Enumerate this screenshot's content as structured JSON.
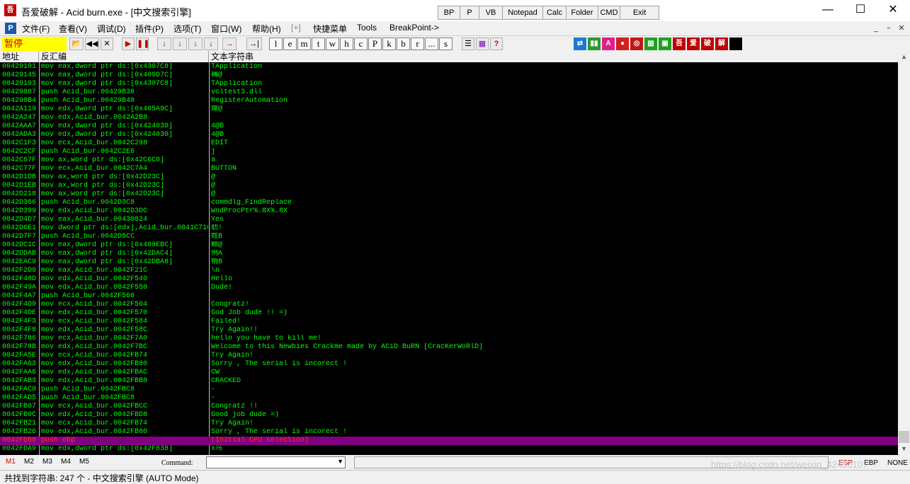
{
  "window": {
    "title": "吾爱破解 - Acid burn.exe - [中文搜索引擎]",
    "app_icon_text": "吾",
    "quick_buttons": [
      "BP",
      "P",
      "VB",
      "Notepad",
      "Calc",
      "Folder",
      "CMD",
      "Exit"
    ],
    "minimize": "—",
    "maximize": "☐",
    "close": "✕"
  },
  "menu": {
    "icon_text": "P",
    "items": [
      "文件(F)",
      "查看(V)",
      "调试(D)",
      "插件(P)",
      "选项(T)",
      "窗口(W)",
      "帮助(H)",
      "[+]",
      "快捷菜单",
      "Tools",
      "BreakPoint->"
    ],
    "mdi_minimize": "_",
    "mdi_restore": "▫",
    "mdi_close": "✕"
  },
  "toolbar": {
    "status": "暂停",
    "debug_icons": [
      "📂",
      "◀◀",
      "✕",
      "▶",
      "❚❚",
      "↓",
      "↓",
      "↓",
      "↓",
      "→"
    ],
    "letters": [
      "l",
      "e",
      "m",
      "t",
      "w",
      "h",
      "c",
      "P",
      "k",
      "b",
      "r",
      "...",
      "s"
    ],
    "view_icons": [
      "☰",
      "▦",
      "?"
    ],
    "color_icons": [
      {
        "glyph": "⇄",
        "color": "#1e78d2"
      },
      {
        "glyph": "▮▮",
        "color": "#2a9a2a"
      },
      {
        "glyph": "A",
        "color": "#e0208a"
      },
      {
        "glyph": "●",
        "color": "#d02020"
      },
      {
        "glyph": "◎",
        "color": "#c01818"
      },
      {
        "glyph": "▥",
        "color": "#20a020"
      },
      {
        "glyph": "▣",
        "color": "#20a020"
      },
      {
        "glyph": "吾",
        "color": "#c00000"
      },
      {
        "glyph": "爱",
        "color": "#c00000"
      },
      {
        "glyph": "破",
        "color": "#c00000"
      },
      {
        "glyph": "解",
        "color": "#c00000"
      },
      {
        "glyph": "",
        "color": "#000000"
      }
    ]
  },
  "table": {
    "headers": [
      "地址",
      "反汇编",
      "文本字符串"
    ],
    "rows": [
      [
        "00429101",
        "mov eax,dword ptr ds:[0x4307C8]",
        "TApplication"
      ],
      [
        "00429145",
        "mov eax,dword ptr ds:[0x409D7C]",
        "鞴@"
      ],
      [
        "00429193",
        "mov eax,dword ptr ds:[0x4307C8]",
        "TApplication"
      ],
      [
        "00429887",
        "push Acid_bur.00429B38",
        "vcltest3.dll"
      ],
      [
        "004298B4",
        "push Acid_bur.00429B48",
        "RegisterAutomation"
      ],
      [
        "0042A119",
        "mov edx,dword ptr ds:[0x405A9C]",
        "煒@"
      ],
      [
        "0042A247",
        "mov edx,Acid_bur.0042A2B8",
        ""
      ],
      [
        "0042AAA7",
        "mov edx,dword ptr ds:[0x424030]",
        "4@B"
      ],
      [
        "0042ADA3",
        "mov edx,dword ptr ds:[0x424030]",
        "4@B"
      ],
      [
        "0042C1F3",
        "mov ecx,Acid_bur.0042C298",
        "EDIT"
      ],
      [
        "0042C2CF",
        "push Acid_bur.0042C2E6",
        "j"
      ],
      [
        "0042C67F",
        "mov ax,word ptr ds:[0x42C6C0]",
        "a"
      ],
      [
        "0042C77F",
        "mov ecx,Acid_bur.0042C7A4",
        "BUTTON"
      ],
      [
        "0042D1DB",
        "mov ax,word ptr ds:[0x42D23C]",
        "@"
      ],
      [
        "0042D1EB",
        "mov ax,word ptr ds:[0x42D23C]",
        "@"
      ],
      [
        "0042D218",
        "mov ax,word ptr ds:[0x42D23C]",
        "@"
      ],
      [
        "0042D366",
        "push Acid_bur.0042D3C8",
        "commdlg_FindReplace"
      ],
      [
        "0042D399",
        "mov edx,Acid_bur.0042D3DC",
        "WndProcPtr%.8X%.8X"
      ],
      [
        "0042D4D7",
        "mov eax,Acid_bur.00430824",
        "Yes"
      ],
      [
        "0042D6E1",
        "mov dword ptr ds:[edx],Acid_bur.0041C710",
        "肋!"
      ],
      [
        "0042D7F7",
        "push Acid_bur.0042D5CC",
        "姓B"
      ],
      [
        "0042DC1C",
        "mov eax,dword ptr ds:[0x409EBC]",
        "鲼@"
      ],
      [
        "0042DDAB",
        "mov eax,dword ptr ds:[0x42DAC4]",
        "例A"
      ],
      [
        "0042EAC9",
        "mov eax,dword ptr ds:[0x42DBA8]",
        "梢B"
      ],
      [
        "0042F2D9",
        "mov eax,Acid_bur.0042F21C",
        "\\n"
      ],
      [
        "0042F48D",
        "mov edx,Acid_bur.0042F540",
        "Hello"
      ],
      [
        "0042F49A",
        "mov edx,Acid_bur.0042F550",
        "Dude!"
      ],
      [
        "0042F4A7",
        "push Acid_bur.0042F560",
        ""
      ],
      [
        "0042F4D9",
        "mov ecx,Acid_bur.0042F564",
        "Congratz!"
      ],
      [
        "0042F4DE",
        "mov edx,Acid_bur.0042F570",
        "God Job dude !! =)"
      ],
      [
        "0042F4F3",
        "mov ecx,Acid_bur.0042F584",
        "Failed!"
      ],
      [
        "0042F4F8",
        "mov edx,Acid_bur.0042F58C",
        "Try Again!!"
      ],
      [
        "0042F786",
        "mov ecx,Acid_bur.0042F7A0",
        "hello you have to kill me!"
      ],
      [
        "0042F78B",
        "mov edx,Acid_bur.0042F7BC",
        "Welcome to this Newbies Crackme made by ACiD BuRN [CracKerWoRlD]"
      ],
      [
        "0042FA5E",
        "mov ecx,Acid_bur.0042FB74",
        "Try Again!"
      ],
      [
        "0042FA63",
        "mov edx,Acid_bur.0042FB80",
        "Sorry , The serial is incorect !"
      ],
      [
        "0042FAA6",
        "mov edx,Acid_bur.0042FBAC",
        "CW"
      ],
      [
        "0042FAB3",
        "mov edx,Acid_bur.0042FBB8",
        "CRACKED"
      ],
      [
        "0042FAC0",
        "push Acid_bur.0042FBC8",
        "-"
      ],
      [
        "0042FAD5",
        "push Acid_bur.0042FBC8",
        "-"
      ],
      [
        "0042FB07",
        "mov ecx,Acid_bur.0042FBCC",
        "Congratz !!"
      ],
      [
        "0042FB0C",
        "mov edx,Acid_bur.0042FBD8",
        "Good job dude =)"
      ],
      [
        "0042FB21",
        "mov ecx,Acid_bur.0042FB74",
        "Try Again!"
      ],
      [
        "0042FB26",
        "mov edx,Acid_bur.0042FB80",
        "Sorry , The serial is incorect !"
      ],
      [
        "0042FD88",
        "push ebp",
        "(Initial CPU selection)"
      ],
      [
        "0042FDA9",
        "mov edx,dword ptr ds:[0x42F838]",
        "x鸟"
      ]
    ],
    "selected_row": 44
  },
  "bottom": {
    "m_buttons": [
      "M1",
      "M2",
      "M3",
      "M4",
      "M5"
    ],
    "command_label": "Command:",
    "registers": [
      "ESP",
      "EBP",
      "NONE"
    ]
  },
  "status": {
    "text": "共找到字符串: 247 个  -  中文搜索引擎 (AUTO Mode)"
  },
  "watermark": "https://blog.csdn.net/weixin_42430107",
  "colors": {
    "text": "#00ff00",
    "bg": "#000000",
    "selected_bg": "#800080",
    "selected_text": "#ff3030"
  }
}
